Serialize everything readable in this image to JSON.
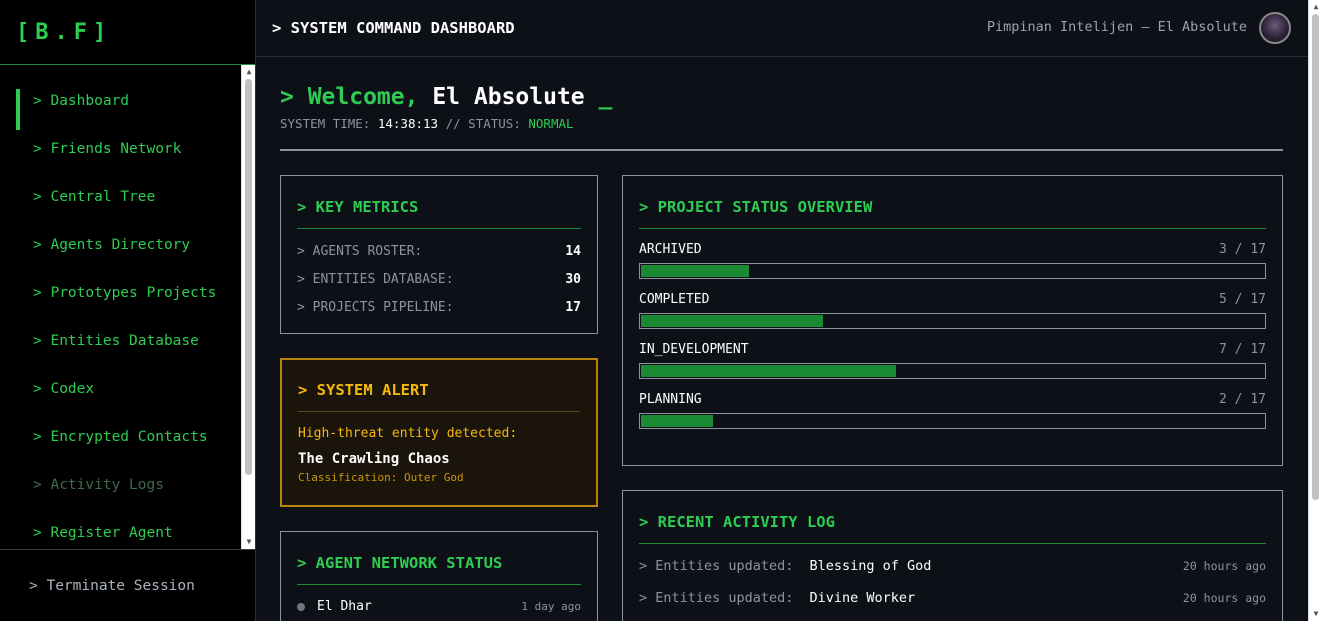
{
  "brand": "[B.F]",
  "sidebar": {
    "items": [
      {
        "label": "> Dashboard"
      },
      {
        "label": "> Friends Network"
      },
      {
        "label": "> Central Tree"
      },
      {
        "label": "> Agents Directory"
      },
      {
        "label": "> Prototypes Projects"
      },
      {
        "label": "> Entities Database"
      },
      {
        "label": "> Codex"
      },
      {
        "label": "> Encrypted Contacts"
      },
      {
        "label": "> Activity Logs"
      },
      {
        "label": "> Register Agent"
      }
    ],
    "logout": "> Terminate Session"
  },
  "header": {
    "title": "> SYSTEM COMMAND DASHBOARD",
    "user": "Pimpinan Intelijen — El Absolute"
  },
  "welcome": {
    "prefix": "> Welcome, ",
    "name": "El Absolute",
    "cursor": " _",
    "time_label": "SYSTEM TIME: ",
    "time": "14:38:13",
    "status_label": " // STATUS: ",
    "status": "NORMAL"
  },
  "metrics": {
    "title": "> KEY METRICS",
    "rows": [
      {
        "label": "> AGENTS ROSTER:",
        "value": "14"
      },
      {
        "label": "> ENTITIES DATABASE:",
        "value": "30"
      },
      {
        "label": "> PROJECTS PIPELINE:",
        "value": "17"
      }
    ]
  },
  "alert": {
    "title": "> SYSTEM ALERT",
    "message": "High-threat entity detected:",
    "entity": "The Crawling Chaos",
    "classification": "Classification: Outer God"
  },
  "network": {
    "title": "> AGENT NETWORK STATUS",
    "agents": [
      {
        "name": "El Dhar",
        "last_seen": "1 day ago"
      }
    ]
  },
  "projects": {
    "title": "> PROJECT STATUS OVERVIEW",
    "items": [
      {
        "status": "ARCHIVED",
        "count": "3 / 17",
        "fraction": 0.1765
      },
      {
        "status": "COMPLETED",
        "count": "5 / 17",
        "fraction": 0.2941
      },
      {
        "status": "IN_DEVELOPMENT",
        "count": "7 / 17",
        "fraction": 0.4118
      },
      {
        "status": "PLANNING",
        "count": "2 / 17",
        "fraction": 0.1176
      }
    ]
  },
  "activity": {
    "title": "> RECENT ACTIVITY LOG",
    "entries": [
      {
        "label": "> Entities updated:",
        "value": "Blessing of God",
        "time": "20 hours ago"
      },
      {
        "label": "> Entities updated:",
        "value": "Divine Worker",
        "time": "20 hours ago"
      }
    ]
  },
  "colors": {
    "accent": "#2ecc52",
    "alert": "#f5b90a",
    "background": "#0d1117"
  }
}
